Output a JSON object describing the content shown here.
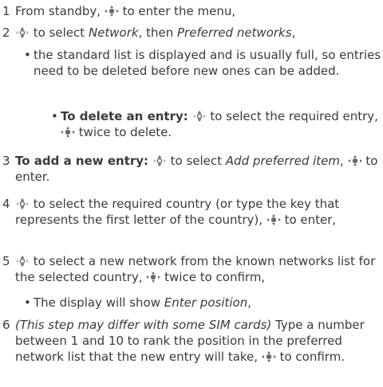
{
  "steps": [
    {
      "num": "1",
      "a": "From standby, ",
      "b": " to enter the menu,"
    },
    {
      "num": "2",
      "a": " to select ",
      "it1": "Network",
      "mid": ", then ",
      "it2": "Preferred networks",
      "end": ","
    },
    {
      "bullet1": "the standard list is displayed and is usually full, so entries need to be deleted before new ones can be added."
    },
    {
      "lead": "To delete an entry:",
      "a": " to select the required entry, ",
      "b": " twice to delete."
    },
    {
      "num": "3",
      "lead": "To add a new entry:",
      "a": " to select ",
      "it1": "Add preferred item",
      "b": ", ",
      "c": " to enter."
    },
    {
      "num": "4",
      "a": " to select the required country (or type the key that represents the first letter of the country), ",
      "b": " to enter,"
    },
    {
      "num": "5",
      "a": " to select a new network from the known networks list for the selected country, ",
      "b": " twice to confirm,"
    },
    {
      "bullet": "The display will show ",
      "it1": "Enter position",
      "end": ","
    },
    {
      "num": "6",
      "it1": "(This step may differ with some SIM cards)",
      "a": " Type a number between 1 and 10 to rank the position in the preferred network list that the new entry will take, ",
      "b": " to confirm."
    }
  ],
  "bullet_char": "•",
  "icons": {
    "nav_color": "#6a6a6a"
  }
}
